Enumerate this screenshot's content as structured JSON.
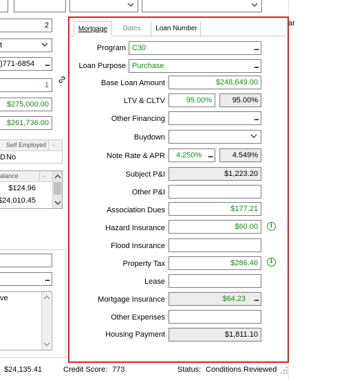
{
  "left_panel": {
    "count_value": "2",
    "select_value": "t",
    "phone_value": ")771-6854",
    "small_value": "1",
    "amount_1": "$275,000.00",
    "amount_2": "$261,736.00",
    "employment_header": "Self Employed",
    "employment_value": "No",
    "employment_left": "D",
    "balance_header": "alance",
    "balance_rows": [
      "$124.96",
      "$24,010.45"
    ],
    "memo_text": "ve"
  },
  "tabs": [
    {
      "label": "Mortgage",
      "active": true
    },
    {
      "label": "Dates",
      "active": false
    },
    {
      "label": "Loan Number",
      "active": false
    }
  ],
  "form": {
    "program_label": "Program",
    "program_value": "C30",
    "loan_purpose_label": "Loan Purpose",
    "loan_purpose_value": "Purchase",
    "base_loan_label": "Base Loan Amount",
    "base_loan_value": "$248,649.00",
    "ltv_label": "LTV & CLTV",
    "ltv_value": "95.00%",
    "cltv_value": "95.00%",
    "other_financing_label": "Other Financing",
    "buydown_label": "Buydown",
    "note_rate_label": "Note Rate & APR",
    "note_rate_value": "4.250%",
    "apr_value": "4.549%",
    "subject_pi_label": "Subject P&I",
    "subject_pi_value": "$1,223.20",
    "other_pi_label": "Other P&I",
    "association_dues_label": "Association Dues",
    "association_dues_value": "$177.21",
    "hazard_insurance_label": "Hazard Insurance",
    "hazard_insurance_value": "$60.00",
    "flood_insurance_label": "Flood Insurance",
    "property_tax_label": "Property Tax",
    "property_tax_value": "$286.46",
    "lease_label": "Lease",
    "mortgage_insurance_label": "Mortgage Insurance",
    "mortgage_insurance_value": "$64.23",
    "other_expenses_label": "Other Expenses",
    "housing_payment_label": "Housing Payment",
    "housing_payment_value": "$1,811.10"
  },
  "status_bar": {
    "total": "$24,135.41",
    "credit_score_label": "Credit Score:",
    "credit_score_value": "773",
    "status_label": "Status:",
    "status_value": "Conditions Reviewed"
  },
  "right_edge_text": "ar",
  "colors": {
    "highlight_border": "#e8191f",
    "value_green": "#1a8a1a",
    "info_icon": "#2e8b2e"
  }
}
